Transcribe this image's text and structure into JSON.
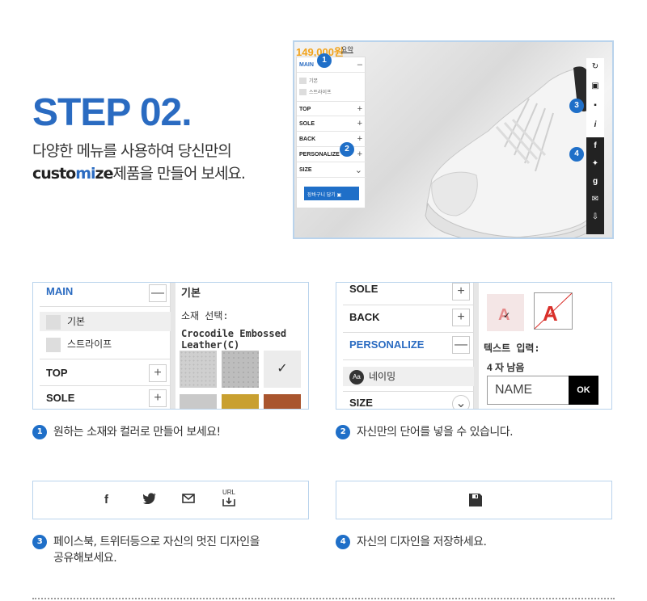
{
  "header": {
    "step": "STEP 02.",
    "desc_line1": "다양한 메뉴를 사용하여 당신만의",
    "desc_custo": "custo",
    "desc_mi": "mi",
    "desc_ze": "ze",
    "desc_rest": "제품을 만들어 보세요."
  },
  "hero": {
    "price": "149,000원",
    "summary_link": "요약",
    "menu": {
      "main": "MAIN",
      "main_btn": "–",
      "sub1": "기본",
      "sub2": "스트라이프",
      "top": "TOP",
      "sole": "SOLE",
      "back": "BACK",
      "personalize": "PERSONALIZE",
      "size": "SIZE",
      "plus": "+",
      "chevron": "⌄",
      "cart_button": "장바구니 담기"
    },
    "badges": [
      "1",
      "2",
      "3",
      "4"
    ],
    "side_icons": [
      "refresh-icon",
      "cart-icon",
      "save-icon",
      "info-icon",
      "facebook-icon",
      "twitter-icon",
      "google-icon",
      "mail-icon",
      "url-icon"
    ],
    "side_glyphs": {
      "i": "i",
      "f": "f",
      "g": "g"
    }
  },
  "panel1": {
    "main": "MAIN",
    "minus": "—",
    "sub1": "기본",
    "sub2": "스트라이프",
    "top": "TOP",
    "sole": "SOLE",
    "plus": "+",
    "content_title": "기본",
    "material_label": "소재 선택:",
    "material_name": "Crocodile Embossed Leather(C)",
    "textures": [
      "#cfcfcf",
      "#bdbdbd",
      "#ececec",
      "#c9c9c9",
      "#c9a030",
      "#a9552e"
    ]
  },
  "panel2": {
    "sole": "SOLE",
    "back": "BACK",
    "personalize": "PERSONALIZE",
    "size": "SIZE",
    "plus": "+",
    "minus": "—",
    "chevron": "⌄",
    "sub_icon": "Aa",
    "sub_name": "네이밍",
    "text_input_label": "텍스트 입력:",
    "remaining": "4 자 남음",
    "name_value": "NAME",
    "ok": "OK"
  },
  "captions": {
    "c1": "원하는 소재와 컬러로 만들어 보세요!",
    "c2": "자신만의 단어를 넣을 수 있습니다.",
    "c3a": "페이스북, 트위터등으로 자신의 멋진 디자인을",
    "c3b": "공유해보세요.",
    "c4": "자신의 디자인을 저장하세요."
  },
  "share": {
    "icons": [
      "facebook-icon",
      "twitter-icon",
      "mail-icon",
      "url-icon"
    ],
    "facebook": "f",
    "url": "URL"
  },
  "colors": {
    "accent": "#2a6bc1",
    "border": "#b9d3ec",
    "price": "#f2a31b"
  }
}
